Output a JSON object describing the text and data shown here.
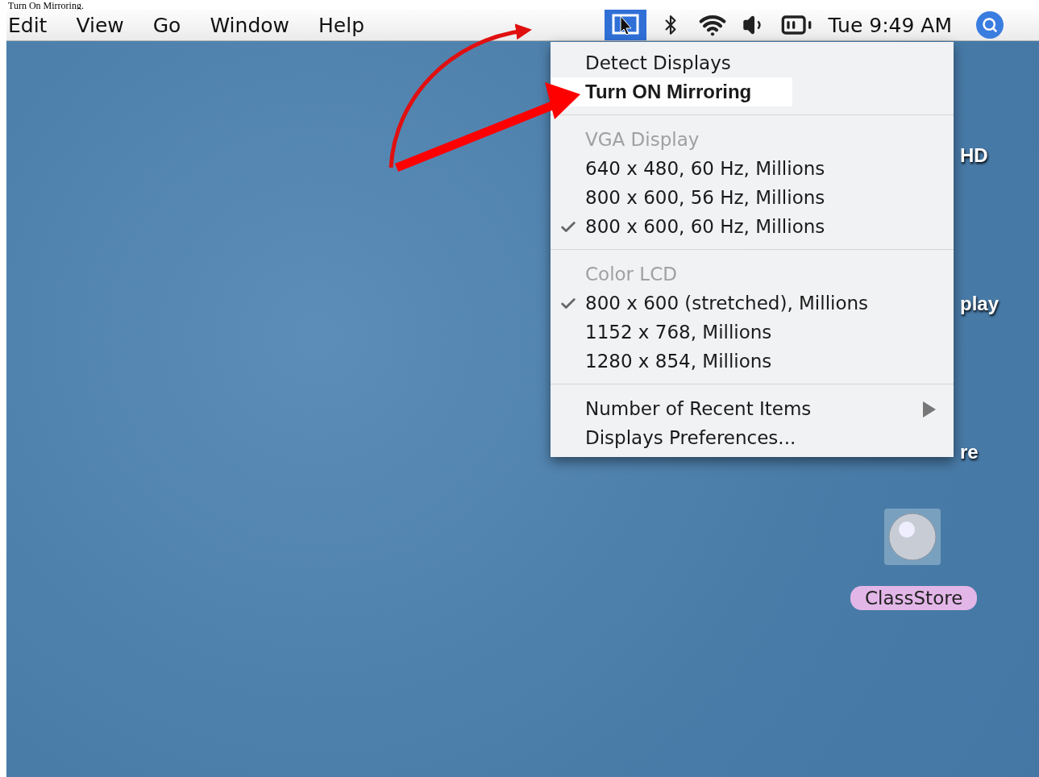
{
  "caption": "Turn On Mirroring.",
  "menubar": {
    "menus": [
      "Edit",
      "View",
      "Go",
      "Window",
      "Help"
    ],
    "status": [
      {
        "kind": "display",
        "selected": true
      },
      {
        "kind": "bluetooth",
        "selected": false
      },
      {
        "kind": "wifi",
        "selected": false
      },
      {
        "kind": "volume",
        "selected": false
      },
      {
        "kind": "battery",
        "selected": false
      }
    ],
    "clock": "Tue 9:49 AM"
  },
  "dropdown": {
    "items": [
      {
        "kind": "action",
        "label": "Detect Displays",
        "highlighted": false
      },
      {
        "kind": "action",
        "label": "Turn ON Mirroring",
        "highlighted": true
      },
      {
        "kind": "separator"
      },
      {
        "kind": "header",
        "label": "VGA Display"
      },
      {
        "kind": "option",
        "label": "640 x 480, 60 Hz, Millions",
        "checked": false
      },
      {
        "kind": "option",
        "label": "800 x 600, 56 Hz, Millions",
        "checked": false
      },
      {
        "kind": "option",
        "label": "800 x 600, 60 Hz, Millions",
        "checked": true
      },
      {
        "kind": "separator"
      },
      {
        "kind": "header",
        "label": "Color LCD"
      },
      {
        "kind": "option",
        "label": "800 x 600 (stretched), Millions",
        "checked": true
      },
      {
        "kind": "option",
        "label": "1152 x 768, Millions",
        "checked": false
      },
      {
        "kind": "option",
        "label": "1280 x 854, Millions",
        "checked": false
      },
      {
        "kind": "separator"
      },
      {
        "kind": "submenu",
        "label": "Number of Recent Items"
      },
      {
        "kind": "action",
        "label": "Displays Preferences...",
        "highlighted": false
      }
    ]
  },
  "desktop": {
    "partial_labels": [
      "HD",
      "play",
      "re"
    ],
    "icons": [
      {
        "label": "ClassStore",
        "selected": true
      }
    ]
  }
}
